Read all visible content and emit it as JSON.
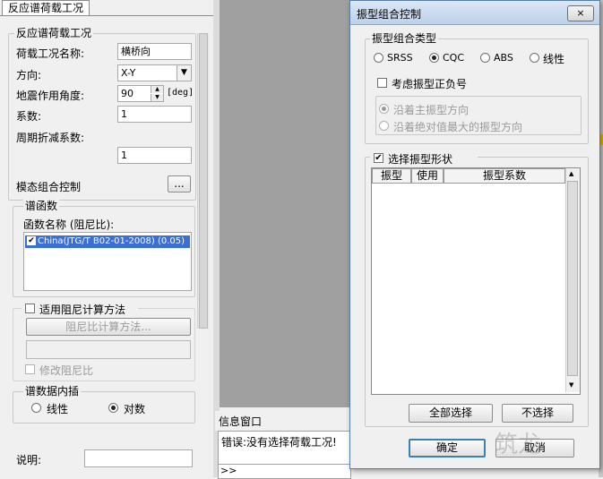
{
  "left_panel": {
    "tab_label": "反应谱荷载工况",
    "group_title": "反应谱荷载工况",
    "load_case_name_label": "荷载工况名称:",
    "load_case_name_value": "横桥向",
    "direction_label": "方向:",
    "direction_value": "X-Y",
    "angle_label": "地震作用角度:",
    "angle_value": "90",
    "angle_unit": "[deg]",
    "coefficient_label": "系数:",
    "coefficient_value": "1",
    "period_label": "周期折减系数:",
    "period_value": "1",
    "modal_label": "模态组合控制",
    "modal_button": "...",
    "spectrum_group_title": "谱函数",
    "function_name_label": "函数名称 (阻尼比):",
    "function_item": "China(JTG/T B02-01-2008) (0.05)",
    "damping_check_label": "适用阻尼计算方法",
    "damping_method_button": "阻尼比计算方法...",
    "modify_damping_label": "修改阻尼比",
    "interp_group_title": "谱数据内插",
    "interp_linear": "线性",
    "interp_log": "对数",
    "description_label": "说明:"
  },
  "info_window": {
    "title": "信息窗口",
    "message": "错误:没有选择荷载工况!",
    "prompt": ">>"
  },
  "dialog": {
    "title": "振型组合控制",
    "close_glyph": "×",
    "combo_group_title": "振型组合类型",
    "radio_srss": "SRSS",
    "radio_cqc": "CQC",
    "radio_abs": "ABS",
    "radio_linear": "线性",
    "sign_check": "考虑振型正负号",
    "dir_main": "沿着主振型方向",
    "dir_abs": "沿着绝对值最大的振型方向",
    "select_check": "选择振型形状",
    "col_mode": "振型",
    "col_use": "使用",
    "col_coef": "振型系数",
    "select_all": "全部选择",
    "deselect": "不选择",
    "ok": "确定",
    "cancel": "取消"
  },
  "watermark": "筑龙"
}
